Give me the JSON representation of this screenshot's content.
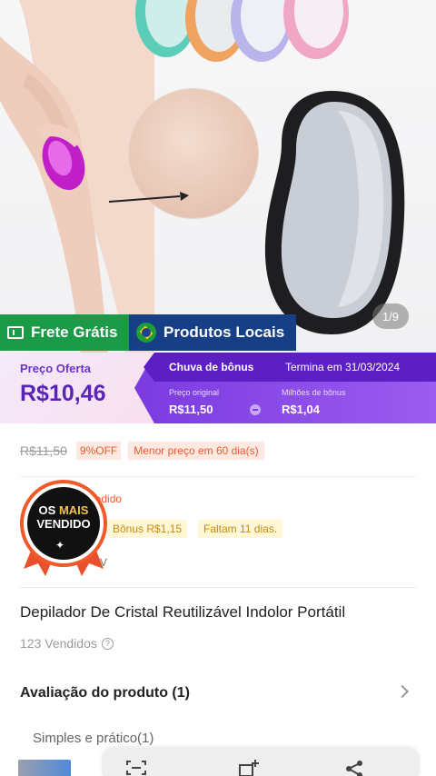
{
  "image": {
    "pager": "1/9",
    "colors": {
      "pink_stone": "#f2a6c6",
      "orange_stone": "#f0a35e",
      "teal_stone": "#5ccdb8",
      "purple_stone": "#b9b4ea",
      "black_stone": "#1e1e20"
    }
  },
  "badges": {
    "frete_label": "Frete Grátis",
    "local_label": "Produtos Locais"
  },
  "price": {
    "offer_label": "Preço Oferta",
    "offer_value": "R$10,46",
    "bonus_title": "Chuva de bônus",
    "bonus_end": "Termina em 31/03/2024",
    "original_label": "Preço original",
    "original_value": "R$11,50",
    "bonus_label": "Milhões de bônus",
    "bonus_value": "R$1,04"
  },
  "old_price": {
    "value": "R$11,50",
    "off": "9%OFF",
    "lowest": "Menor preço em 60 dia(s)"
  },
  "bonus_info": {
    "text": "pedido",
    "chip1": "Bônus R$1,15",
    "chip2": "Faltam 11 dias.",
    "small": "V"
  },
  "seal": {
    "line1_a": "OS ",
    "line1_b": "MAIS",
    "line2": "VENDIDO",
    "star": "✦"
  },
  "product": {
    "title": "Depilador De Cristal Reutilizável Indolor Portátil",
    "sold": "123 Vendidos",
    "info_icon": "?"
  },
  "review": {
    "title": "Avaliação do produto (1)",
    "item": "Simples e prático(1)"
  }
}
